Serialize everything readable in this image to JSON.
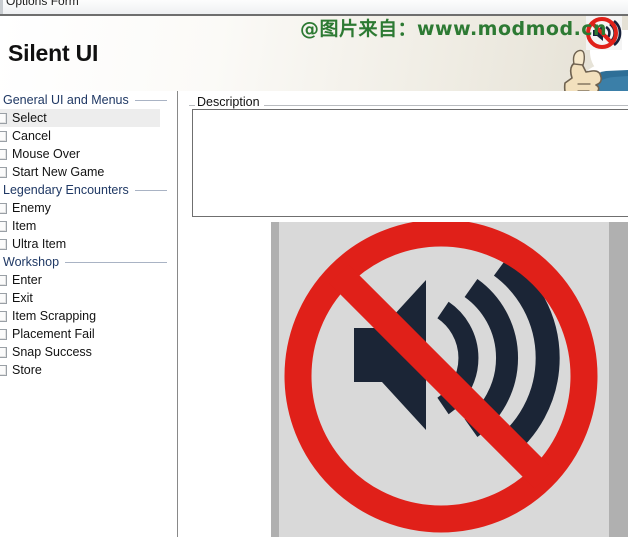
{
  "window": {
    "titlebar_text": "Options Form"
  },
  "header": {
    "app_title": "Silent UI",
    "watermark": "@图片来自：www.modmod.cn",
    "mascot_icon": "thumbs-up-character",
    "mascot_badge_icon": "mute-speaker-icon"
  },
  "sidebar": {
    "sections": [
      {
        "title": "General UI and Menus",
        "items": [
          {
            "label": "Select",
            "checked": false,
            "selected": true
          },
          {
            "label": "Cancel",
            "checked": false,
            "selected": false
          },
          {
            "label": "Mouse Over",
            "checked": false,
            "selected": false
          },
          {
            "label": "Start New Game",
            "checked": false,
            "selected": false
          }
        ]
      },
      {
        "title": "Legendary Encounters",
        "items": [
          {
            "label": "Enemy",
            "checked": false,
            "selected": false
          },
          {
            "label": "Item",
            "checked": false,
            "selected": false
          },
          {
            "label": "Ultra Item",
            "checked": false,
            "selected": false
          }
        ]
      },
      {
        "title": "Workshop",
        "items": [
          {
            "label": "Enter",
            "checked": false,
            "selected": false
          },
          {
            "label": "Exit",
            "checked": false,
            "selected": false
          },
          {
            "label": "Item Scrapping",
            "checked": false,
            "selected": false
          },
          {
            "label": "Placement Fail",
            "checked": false,
            "selected": false
          },
          {
            "label": "Snap Success",
            "checked": false,
            "selected": false
          },
          {
            "label": "Store",
            "checked": false,
            "selected": false
          }
        ]
      }
    ]
  },
  "main": {
    "description_legend": "Description",
    "description_value": "",
    "description_placeholder": "",
    "preview_image_name": "no-sound-mute-symbol"
  },
  "colors": {
    "section_header_text": "#1f3864",
    "selected_row_bg": "#ededed",
    "watermark_green": "#2d7a33",
    "prohibition_red": "#e02019",
    "speaker_navy": "#1b2536",
    "preview_bg_gray": "#b0b0b0"
  }
}
